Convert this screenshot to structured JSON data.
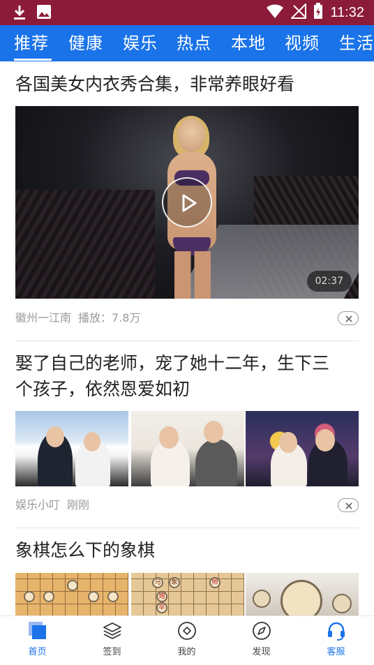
{
  "status_bar": {
    "time": "11:32"
  },
  "tabs": [
    "推荐",
    "健康",
    "娱乐",
    "热点",
    "本地",
    "视频",
    "生活"
  ],
  "feed": [
    {
      "title": "各国美女内衣秀合集，非常养眼好看",
      "duration": "02:37",
      "source": "徽州一江南",
      "plays": "播放：7.8万"
    },
    {
      "title_line1": "娶了自己的老师，宠了她十二年，生下三",
      "title_line2": "个孩子，依然恩爱如初",
      "source": "娱乐小叮",
      "time": "刚刚"
    },
    {
      "title": "象棋怎么下的象棋"
    }
  ],
  "chess_pieces": [
    "马",
    "炮",
    "象",
    "卒",
    "帅"
  ],
  "bottom_nav": [
    {
      "label": "首页",
      "icon": "home-square-icon",
      "active": true
    },
    {
      "label": "签到",
      "icon": "layers-icon"
    },
    {
      "label": "我的",
      "icon": "circle-diamond-icon"
    },
    {
      "label": "发现",
      "icon": "compass-icon"
    },
    {
      "label": "客服",
      "icon": "headset-icon"
    }
  ],
  "colors": {
    "status_bar": "#8c1b3a",
    "tab_bar": "#1a73e8",
    "active_nav": "#1a73e8"
  }
}
